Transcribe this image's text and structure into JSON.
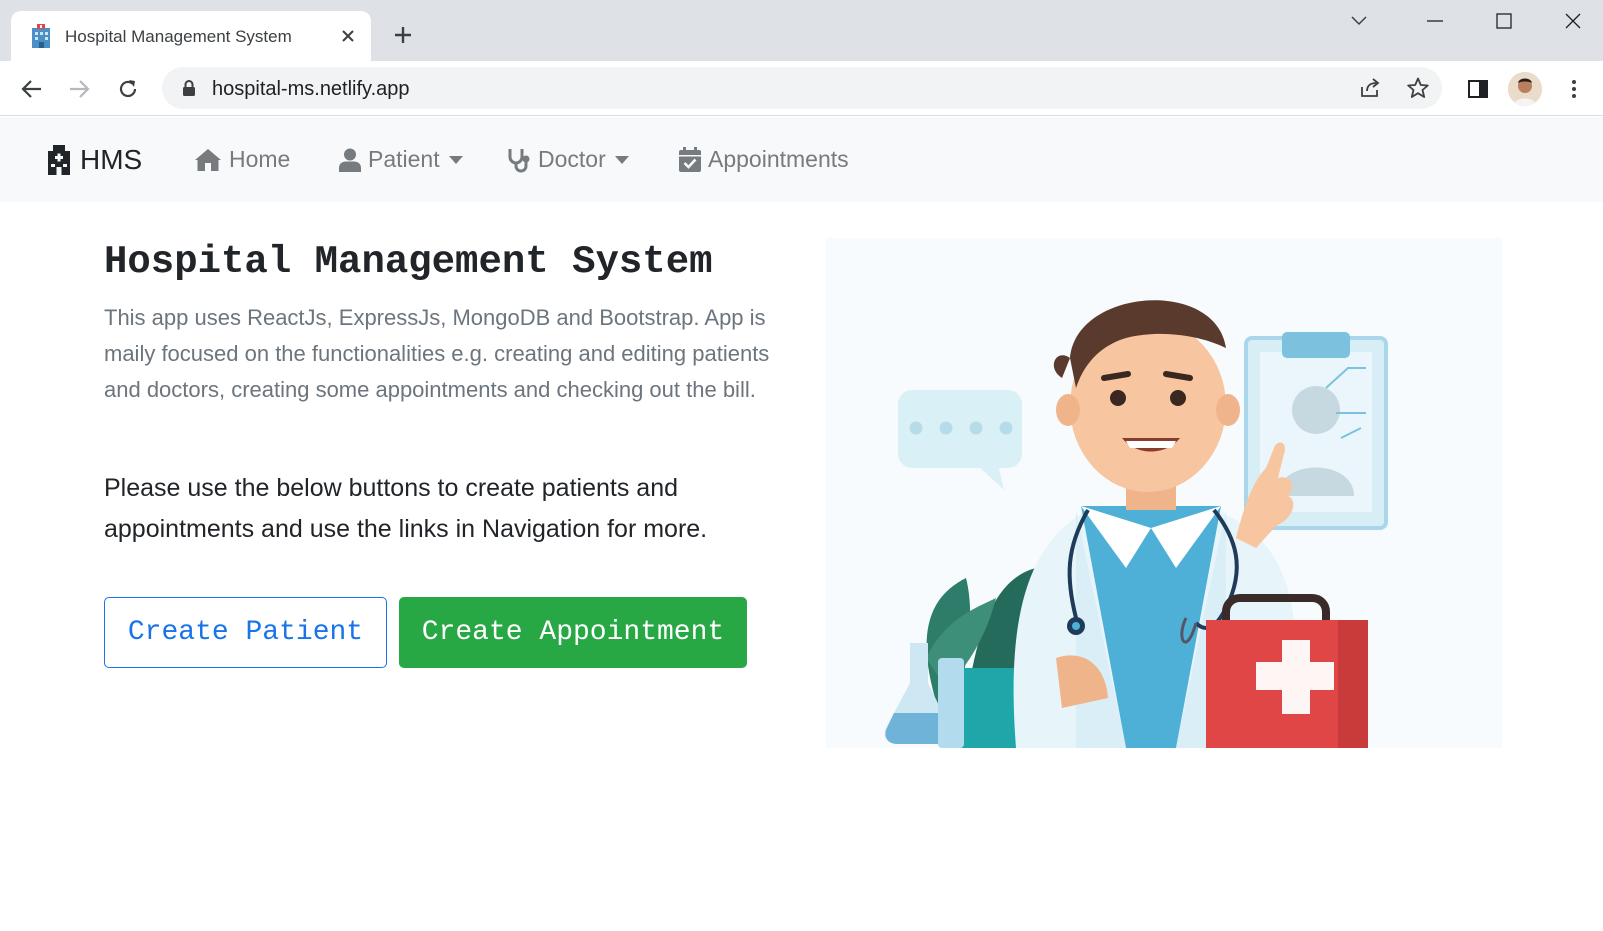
{
  "browser": {
    "tab_title": "Hospital Management System",
    "url": "hospital-ms.netlify.app"
  },
  "navbar": {
    "brand": "HMS",
    "items": [
      {
        "label": "Home",
        "icon": "home-icon",
        "dropdown": false
      },
      {
        "label": "Patient",
        "icon": "user-icon",
        "dropdown": true
      },
      {
        "label": "Doctor",
        "icon": "stethoscope-icon",
        "dropdown": true
      },
      {
        "label": "Appointments",
        "icon": "calendar-check-icon",
        "dropdown": false
      }
    ]
  },
  "main": {
    "title": "Hospital Management System",
    "description": "This app uses ReactJs, ExpressJs, MongoDB and Bootstrap. App is maily focused on the functionalities e.g. creating and editing patients and doctors, creating some appointments and checking out the bill.",
    "instruction": "Please use the below buttons to create patients and appointments and use the links in Navigation for more.",
    "create_patient_label": "Create Patient",
    "create_appointment_label": "Create Appointment"
  },
  "colors": {
    "primary": "#1874e8",
    "success": "#28a745",
    "navbar_bg": "#f8f9fa",
    "muted_text": "#6c757d"
  }
}
